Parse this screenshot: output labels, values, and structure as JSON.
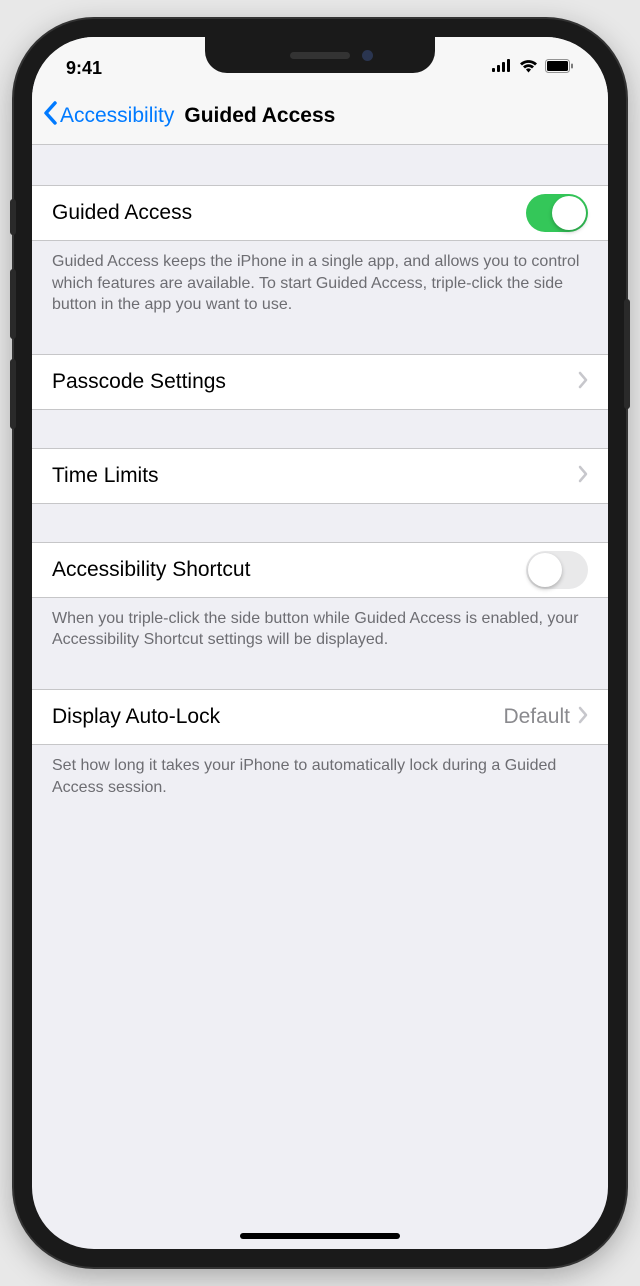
{
  "statusBar": {
    "time": "9:41"
  },
  "nav": {
    "back": "Accessibility",
    "title": "Guided Access"
  },
  "sections": {
    "guidedAccess": {
      "label": "Guided Access",
      "enabled": true,
      "footer": "Guided Access keeps the iPhone in a single app, and allows you to control which features are available. To start Guided Access, triple-click the side button in the app you want to use."
    },
    "passcode": {
      "label": "Passcode Settings"
    },
    "timeLimits": {
      "label": "Time Limits"
    },
    "shortcut": {
      "label": "Accessibility Shortcut",
      "enabled": false,
      "footer": "When you triple-click the side button while Guided Access is enabled, your Accessibility Shortcut settings will be displayed."
    },
    "autoLock": {
      "label": "Display Auto-Lock",
      "value": "Default",
      "footer": "Set how long it takes your iPhone to automatically lock during a Guided Access session."
    }
  }
}
